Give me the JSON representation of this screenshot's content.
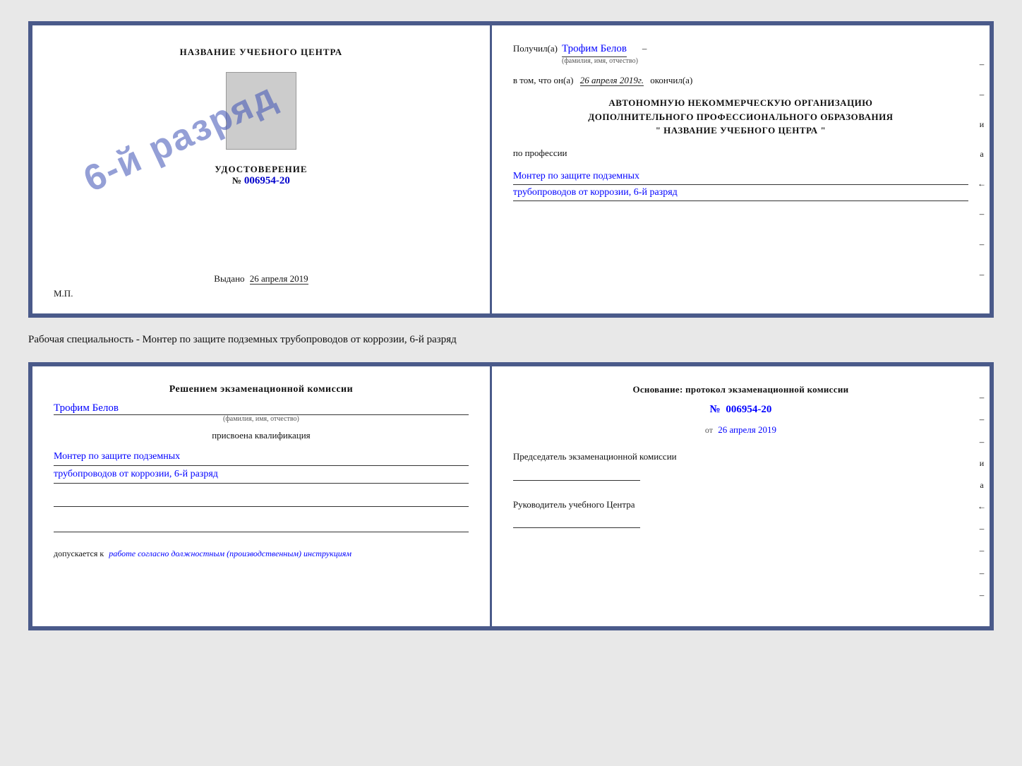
{
  "page": {
    "background": "#e8e8e8"
  },
  "top_cert": {
    "left": {
      "org_name": "НАЗВАНИЕ УЧЕБНОГО ЦЕНТРА",
      "stamp_text": "6-й разряд",
      "cert_type_label": "УДОСТОВЕРЕНИЕ",
      "cert_number_prefix": "№",
      "cert_number": "006954-20",
      "issued_prefix": "Выдано",
      "issued_date": "26 апреля 2019",
      "mp_label": "М.П."
    },
    "right": {
      "received_label": "Получил(а)",
      "recipient_name": "Трофим Белов",
      "recipient_sublabel": "(фамилия, имя, отчество)",
      "date_prefix": "в том, что он(а)",
      "date_value": "26 апреля 2019г.",
      "completed_label": "окончил(а)",
      "org_block_line1": "АВТОНОМНУЮ НЕКОММЕРЧЕСКУЮ ОРГАНИЗАЦИЮ",
      "org_block_line2": "ДОПОЛНИТЕЛЬНОГО ПРОФЕССИОНАЛЬНОГО ОБРАЗОВАНИЯ",
      "org_block_line3": "\"   НАЗВАНИЕ УЧЕБНОГО ЦЕНТРА   \"",
      "profession_label": "по профессии",
      "profession_value1": "Монтер по защите подземных",
      "profession_value2": "трубопроводов от коррозии, 6-й разряд",
      "side_chars": [
        "–",
        "–",
        "и",
        "а",
        "←",
        "–",
        "–",
        "–"
      ]
    }
  },
  "middle": {
    "text": "Рабочая специальность - Монтер по защите подземных трубопроводов от коррозии, 6-й разряд"
  },
  "bottom_cert": {
    "left": {
      "commission_title": "Решением экзаменационной комиссии",
      "person_name": "Трофим Белов",
      "person_sublabel": "(фамилия, имя, отчество)",
      "assigned_label": "присвоена квалификация",
      "qualification1": "Монтер по защите подземных",
      "qualification2": "трубопроводов от коррозии, 6-й разряд",
      "admission_prefix": "допускается к",
      "admission_value": "работе согласно должностным (производственным) инструкциям"
    },
    "right": {
      "basis_label": "Основание: протокол экзаменационной комиссии",
      "protocol_prefix": "№",
      "protocol_number": "006954-20",
      "date_ot_label": "от",
      "date_value": "26 апреля 2019",
      "chairman_label": "Председатель экзаменационной комиссии",
      "leader_label": "Руководитель учебного Центра",
      "side_chars": [
        "–",
        "–",
        "–",
        "и",
        "а",
        "←",
        "–",
        "–",
        "–",
        "–"
      ]
    }
  }
}
